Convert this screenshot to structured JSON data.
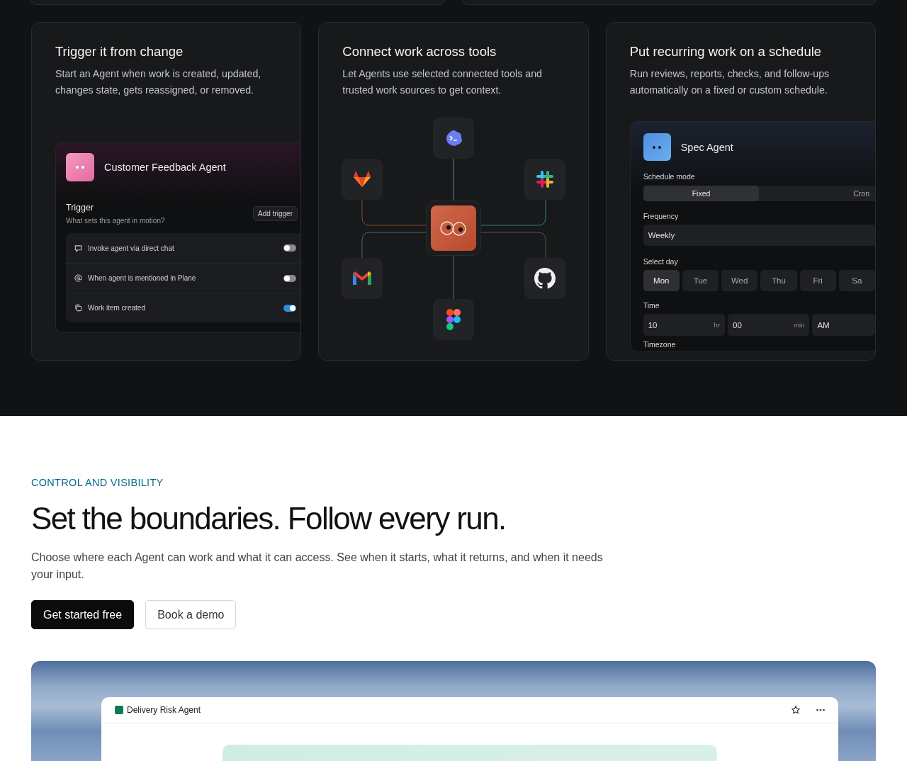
{
  "feature_cards": [
    {
      "kind": "trigger",
      "title": "Trigger it from change",
      "description": "Start an Agent when work is created, updated, changes state, gets reassigned, or removed.",
      "agent_name": "Customer Feedback Agent",
      "trigger_label": "Trigger",
      "trigger_hint": "What sets this agent in motion?",
      "add_button": "Add trigger",
      "options": [
        {
          "label": "Invoke agent via direct chat",
          "on": false
        },
        {
          "label": "When agent is mentioned in Plane",
          "on": false
        },
        {
          "label": "Work item created",
          "on": true
        }
      ]
    },
    {
      "kind": "integrations",
      "title": "Connect work across tools",
      "description": "Let Agents use selected connected tools and trusted work sources to get context."
    },
    {
      "kind": "schedule",
      "title": "Put recurring work on a schedule",
      "description": "Run reviews, reports, checks, and follow-ups automatically on a fixed or custom schedule.",
      "agent_name": "Spec Agent",
      "mode_label": "Schedule mode",
      "modes": [
        {
          "label": "Fixed",
          "selected": true
        },
        {
          "label": "Cron",
          "selected": false
        }
      ],
      "frequency_label": "Frequency",
      "frequency": "Weekly",
      "day_label": "Select day",
      "days": [
        {
          "label": "Mon",
          "selected": true
        },
        {
          "label": "Tue",
          "selected": false
        },
        {
          "label": "Wed",
          "selected": false
        },
        {
          "label": "Thu",
          "selected": false
        },
        {
          "label": "Fri",
          "selected": false
        },
        {
          "label": "Sa",
          "selected": false
        }
      ],
      "time_label": "Time",
      "hour": "10",
      "hour_unit": "hr",
      "minute": "00",
      "minute_unit": "min",
      "period": "AM",
      "timezone_label": "Timezone"
    }
  ],
  "section": {
    "eyebrow": "CONTROL AND VISIBILITY",
    "heading": "Set the boundaries. Follow every run.",
    "body": "Choose where each Agent can work and what it can access. See when it starts, what it returns, and when it needs your input.",
    "buttons": [
      {
        "label": "Get started free",
        "kind": "primary"
      },
      {
        "label": "Book a demo",
        "kind": "secondary"
      }
    ]
  },
  "preview": {
    "window_title": "Delivery Risk Agent"
  }
}
